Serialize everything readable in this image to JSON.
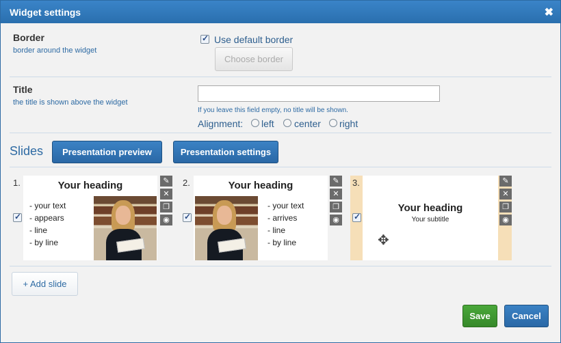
{
  "dialog": {
    "title": "Widget settings",
    "close": "✖"
  },
  "border": {
    "label": "Border",
    "sublabel": "border around the widget",
    "checkbox_label": "Use default border",
    "choose_button": "Choose border"
  },
  "title_field": {
    "label": "Title",
    "sublabel": "the title is shown above the widget",
    "value": "",
    "hint": "If you leave this field empty, no title will be shown.",
    "alignment_label": "Alignment:",
    "options": [
      "left",
      "center",
      "right"
    ]
  },
  "slides": {
    "title": "Slides",
    "preview_button": "Presentation preview",
    "settings_button": "Presentation settings",
    "items": [
      {
        "num": "1.",
        "heading": "Your heading",
        "lines": [
          "- your text",
          "- appears",
          "- line",
          "- by line"
        ]
      },
      {
        "num": "2.",
        "heading": "Your heading",
        "lines": [
          "- your text",
          "- arrives",
          "- line",
          "- by line"
        ]
      },
      {
        "num": "3.",
        "heading": "Your heading",
        "subtitle": "Your subtitle"
      }
    ],
    "tools": {
      "edit": "✎",
      "delete": "✕",
      "copy": "❐",
      "view": "◉"
    },
    "add_button": "+ Add slide"
  },
  "footer": {
    "save": "Save",
    "cancel": "Cancel"
  },
  "icons": {
    "move": "✥"
  }
}
